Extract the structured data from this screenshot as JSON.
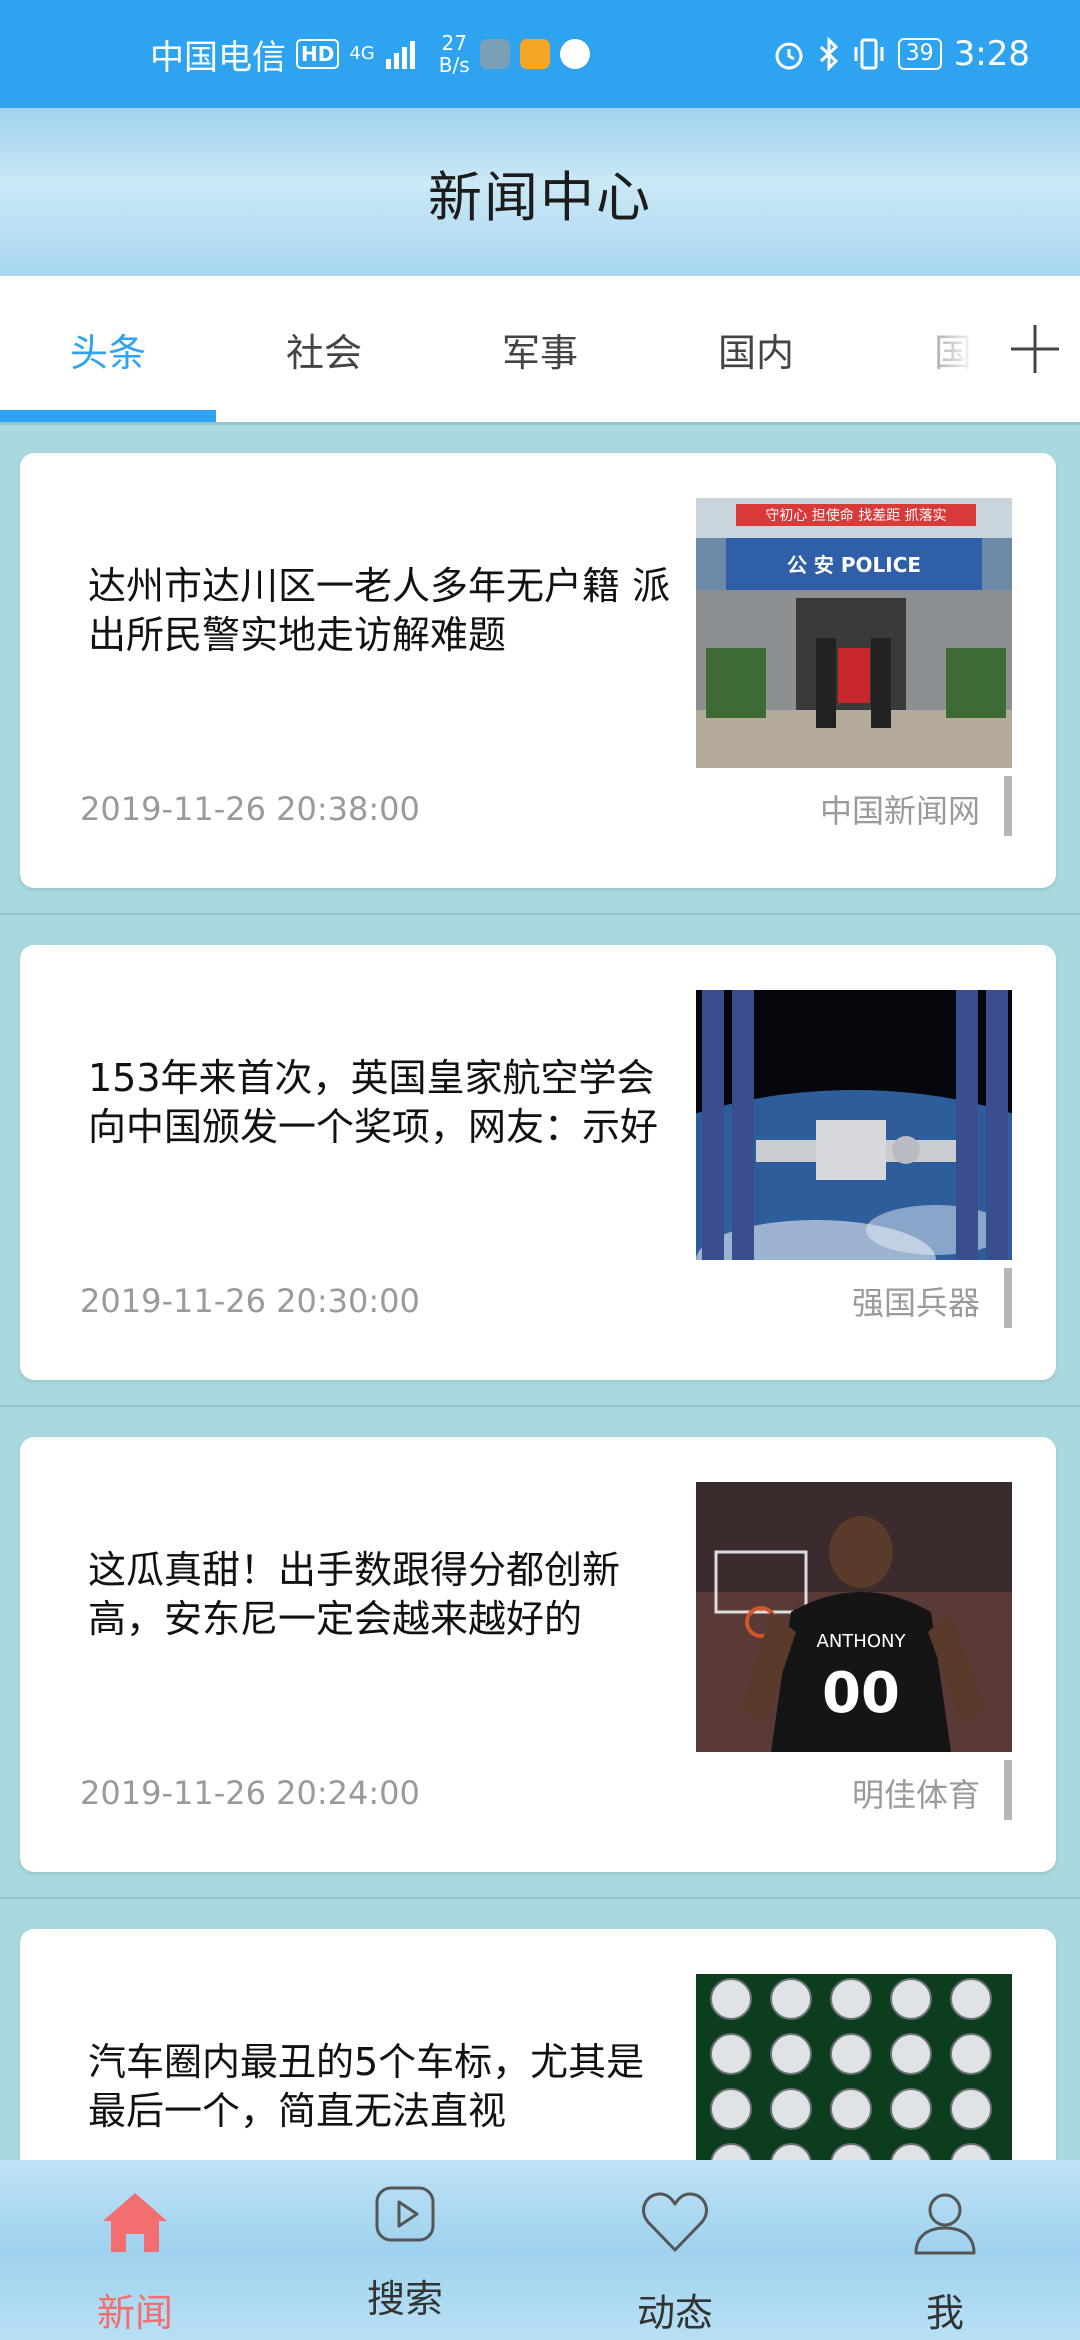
{
  "status_bar": {
    "carrier": "中国电信",
    "hd": "HD",
    "net_type": "4G",
    "speed_value": "27",
    "speed_unit": "B/s",
    "battery": "39",
    "time": "3:28"
  },
  "header": {
    "title": "新闻中心"
  },
  "tabs": [
    {
      "label": "头条",
      "active": true
    },
    {
      "label": "社会"
    },
    {
      "label": "军事"
    },
    {
      "label": "国内"
    },
    {
      "label": "国际"
    }
  ],
  "articles": [
    {
      "headline": "达州市达川区一老人多年无户籍 派出所民警实地走访解难题",
      "time": "2019-11-26 20:38:00",
      "source": "中国新闻网",
      "thumb_icon": "police-station-image",
      "thumb_sign": "公 安  POLICE",
      "thumb_banner": "守初心 担使命 找差距 抓落实"
    },
    {
      "headline": "153年来首次，英国皇家航空学会向中国颁发一个奖项，网友：示好",
      "time": "2019-11-26 20:30:00",
      "source": "强国兵器",
      "thumb_icon": "space-station-image"
    },
    {
      "headline": "这瓜真甜！出手数跟得分都创新高，安东尼一定会越来越好的",
      "time": "2019-11-26 20:24:00",
      "source": "明佳体育",
      "thumb_icon": "basketball-player-image",
      "thumb_jersey_name": "ANTHONY",
      "thumb_jersey_number": "00"
    },
    {
      "headline": "汽车圈内最丑的5个车标，尤其是最后一个，简直无法直视",
      "thumb_icon": "car-logos-image"
    }
  ],
  "bottom_nav": [
    {
      "label": "新闻",
      "icon": "home-icon",
      "active": true
    },
    {
      "label": "搜索",
      "icon": "play-icon"
    },
    {
      "label": "动态",
      "icon": "heart-icon"
    },
    {
      "label": "我",
      "icon": "user-icon"
    }
  ],
  "colors": {
    "accent": "#2ea3f0",
    "active_nav": "#f36f6f",
    "feed_bg": "#a9d9de"
  }
}
